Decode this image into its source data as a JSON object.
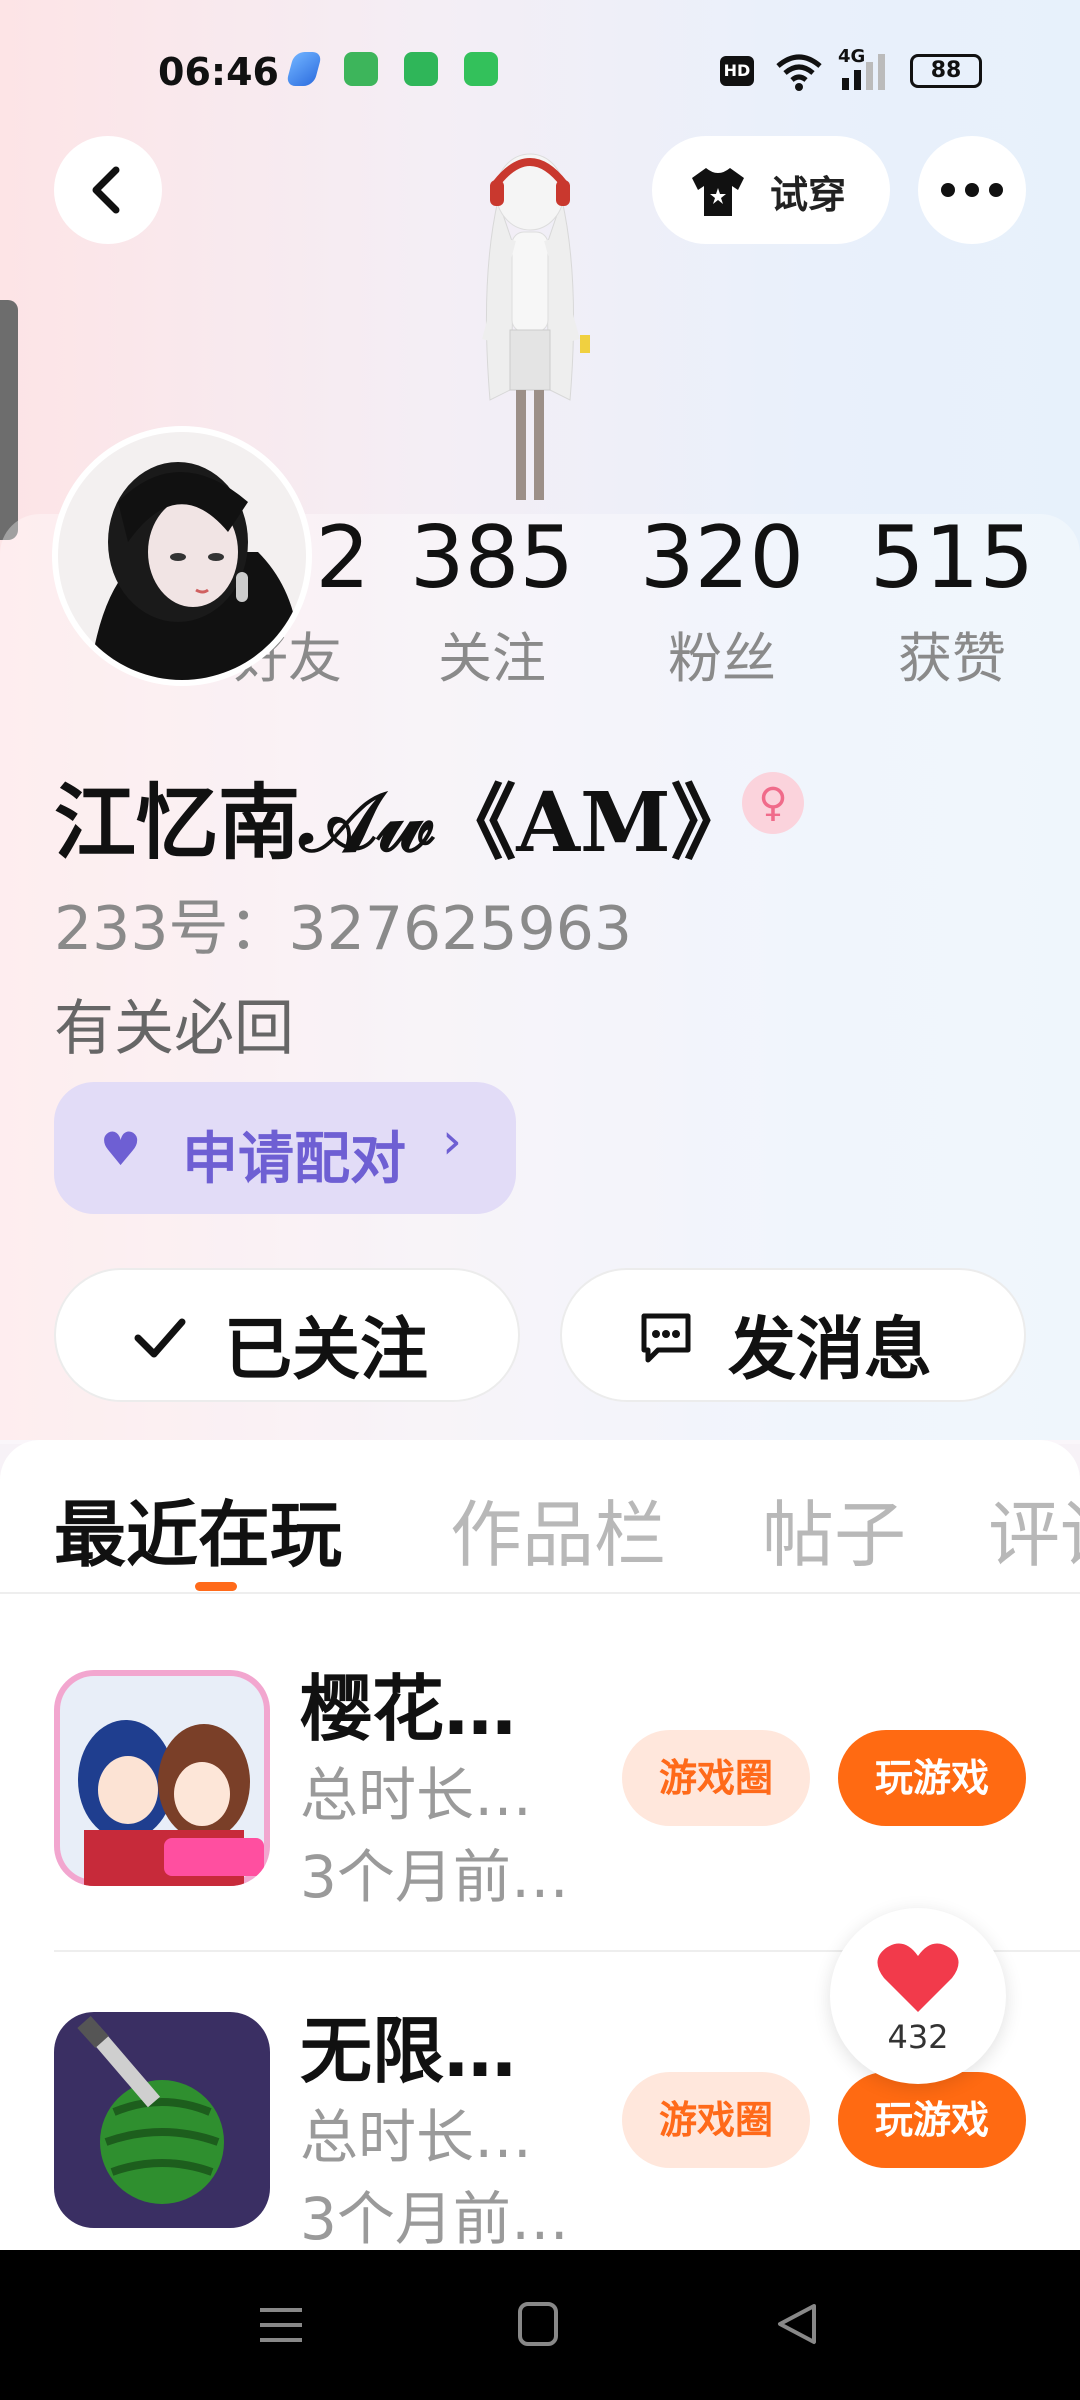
{
  "status_bar": {
    "time": "06:46",
    "hd_label": "HD",
    "network": "4G",
    "battery": "88"
  },
  "header": {
    "back_icon": "chevron-left-icon",
    "tryon_label": "试穿",
    "more_icon": "more-dots-icon"
  },
  "profile": {
    "stats": [
      {
        "value": "282",
        "label": "好友"
      },
      {
        "value": "385",
        "label": "关注"
      },
      {
        "value": "320",
        "label": "粉丝"
      },
      {
        "value": "515",
        "label": "获赞"
      }
    ],
    "name": "江忆南𝒜𝓌《AM》",
    "gender_symbol": "♀",
    "uid": "233号：327625963",
    "bio": "有关必回",
    "pair_label": "申请配对",
    "pair_arrow": "›",
    "following_label": "已关注",
    "message_label": "发消息"
  },
  "tabs": [
    {
      "label": "最近在玩",
      "active": true
    },
    {
      "label": "作品栏",
      "active": false
    },
    {
      "label": "帖子",
      "active": false
    },
    {
      "label": "评论",
      "active": false
    }
  ],
  "games": [
    {
      "title": "樱花…",
      "duration": "总时长…",
      "last_played": "3个月前…",
      "circle_label": "游戏圈",
      "play_label": "玩游戏"
    },
    {
      "title": "无限…",
      "duration": "总时长…",
      "last_played": "3个月前…",
      "circle_label": "游戏圈",
      "play_label": "玩游戏"
    }
  ],
  "like": {
    "count": "432"
  },
  "colors": {
    "accent": "#ff6a12",
    "pair": "#6e5fd3"
  }
}
